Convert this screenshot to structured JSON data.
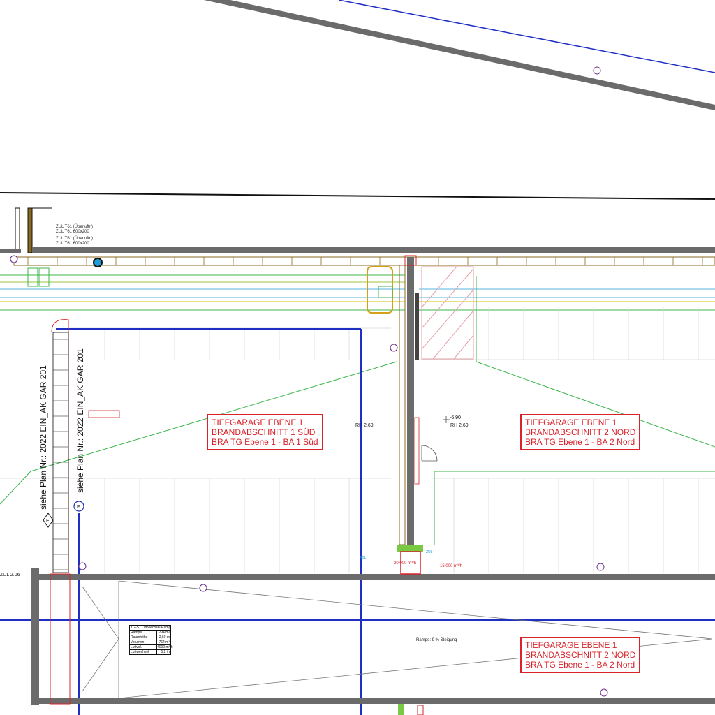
{
  "zones": [
    {
      "id": "ba1-sued",
      "lines": [
        "TIEFGARAGE EBENE 1",
        "BRANDABSCHNITT 1 SÜD",
        "BRA TG Ebene 1 - BA 1 Süd"
      ]
    },
    {
      "id": "ba2-nord-upper",
      "lines": [
        "TIEFGARAGE EBENE 1",
        "BRANDABSCHNITT 2 NORD",
        "BRA TG Ebene 1 - BA 2 Nord"
      ]
    },
    {
      "id": "ba2-nord-lower",
      "lines": [
        "TIEFGARAGE EBENE 1",
        "BRANDABSCHNITT 2 NORD",
        "BRA TG Ebene 1 - BA 2 Nord"
      ]
    }
  ],
  "plan_refs": [
    {
      "text": "siehe Plan Nr.: 2022 EIN_AK GAR 201",
      "marker": "E"
    },
    {
      "text": "siehe Plan Nr.: 2022 EIN_AK GAR 201",
      "marker": "F"
    }
  ],
  "room_heights": [
    "RH 2,69",
    "RH 2,69"
  ],
  "level_mark": "-6,90",
  "left_label": "ZUL 2.06",
  "ramp_note": "Rampe: 9 % Steigung",
  "ramp_table": {
    "title": "TG-S1 Luftwechsel Rampe",
    "rows": [
      [
        "Rampe",
        "294 m²"
      ],
      [
        "Raumhöhe",
        "2,60 m"
      ],
      [
        "Volumen",
        "764 m³"
      ],
      [
        "Luftvol.",
        "4000 m³/h"
      ],
      [
        "Luftwechsel",
        "5,2 /h"
      ]
    ]
  },
  "flow_values": [
    "20 000 m³/h",
    "15 000 m³/h"
  ],
  "colors": {
    "zone_red": "#d8232a",
    "axis_blue": "#1f2fc4",
    "green_line": "#3bb54a",
    "wall_gray": "#6b6b6b",
    "cyan": "#1e9bd7"
  }
}
